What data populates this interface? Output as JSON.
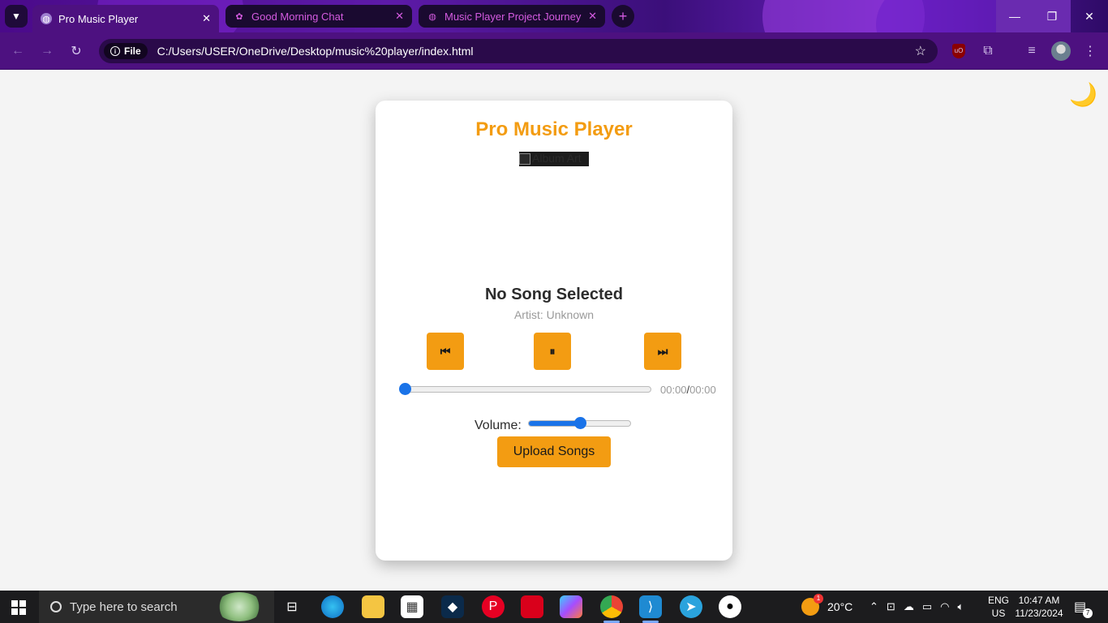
{
  "browser": {
    "tabs": [
      {
        "title": "Pro Music Player",
        "active": true
      },
      {
        "title": "Good Morning Chat",
        "active": false
      },
      {
        "title": "Music Player Project Journey",
        "active": false
      }
    ],
    "address": {
      "chip_label": "File",
      "url": "C:/Users/USER/OneDrive/Desktop/music%20player/index.html"
    }
  },
  "page": {
    "theme_toggle": "🌙",
    "title": "Pro Music Player",
    "album_alt": "Album Art",
    "song_title": "No Song Selected",
    "artist": "Artist: Unknown",
    "controls": {
      "prev": "⏮",
      "play_pause": "⏸",
      "next": "⏭"
    },
    "progress": {
      "value": 0,
      "current": "00:00",
      "separator": "/",
      "duration": "00:00"
    },
    "volume": {
      "label": "Volume:",
      "value": 0.5
    },
    "upload_label": "Upload Songs",
    "accent_color": "#f39c12",
    "slider_color": "#1a73e8"
  },
  "taskbar": {
    "search_placeholder": "Type here to search",
    "weather": "20°C",
    "weather_badge": "1",
    "language": "ENG",
    "region": "US",
    "time": "10:47 AM",
    "date": "11/23/2024",
    "notifications": "7"
  }
}
